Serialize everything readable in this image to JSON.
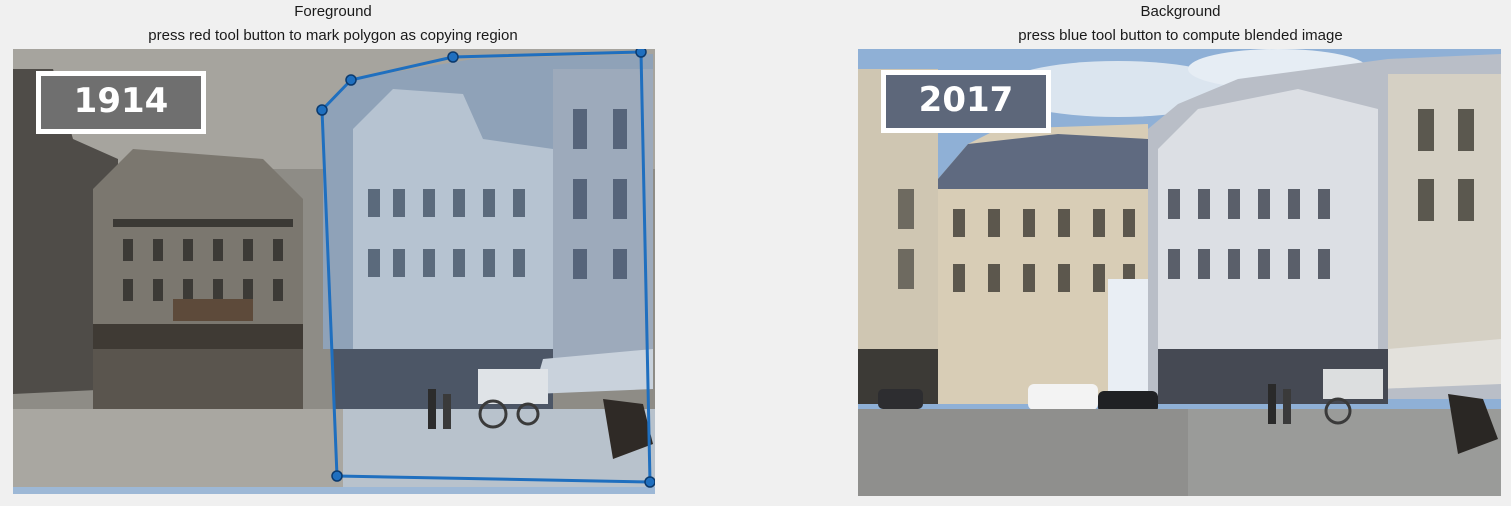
{
  "figure": {
    "left_panel": {
      "title": "Foreground",
      "subtitle": "press red tool button to mark polygon as copying region",
      "year_label": "1914"
    },
    "right_panel": {
      "title": "Background",
      "subtitle": "press blue tool button to compute blended image",
      "year_label": "2017"
    }
  },
  "colors": {
    "polygon_stroke": "#1f6fbf",
    "polygon_vertex": "#1f6fbf",
    "background": "#f0f0f0"
  }
}
